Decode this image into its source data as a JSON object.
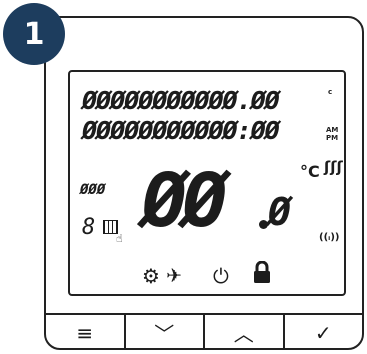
{
  "step": {
    "number": "1"
  },
  "display": {
    "top_row": "ØØØØØØØØØØØ.ØØ",
    "top_row_suffix": "c",
    "second_row": "ØØØØØØØØØØØ:ØØ",
    "ampm_top": "AM",
    "ampm_bottom": "PM",
    "main_digits": "ØØ",
    "decimal_digit": "Ø",
    "left_small_digits": "ØØØ",
    "day_digit": "8",
    "unit": "°C",
    "heat_symbol": "ʃʃʃ",
    "signal_symbol": "((ᵢ))"
  },
  "icons": {
    "gear": "⚙",
    "plane": "✈",
    "power": "⏻",
    "lock": "lock"
  },
  "buttons": [
    {
      "label": "≡"
    },
    {
      "label": "﹀"
    },
    {
      "label": "︿"
    },
    {
      "label": "✓"
    }
  ]
}
